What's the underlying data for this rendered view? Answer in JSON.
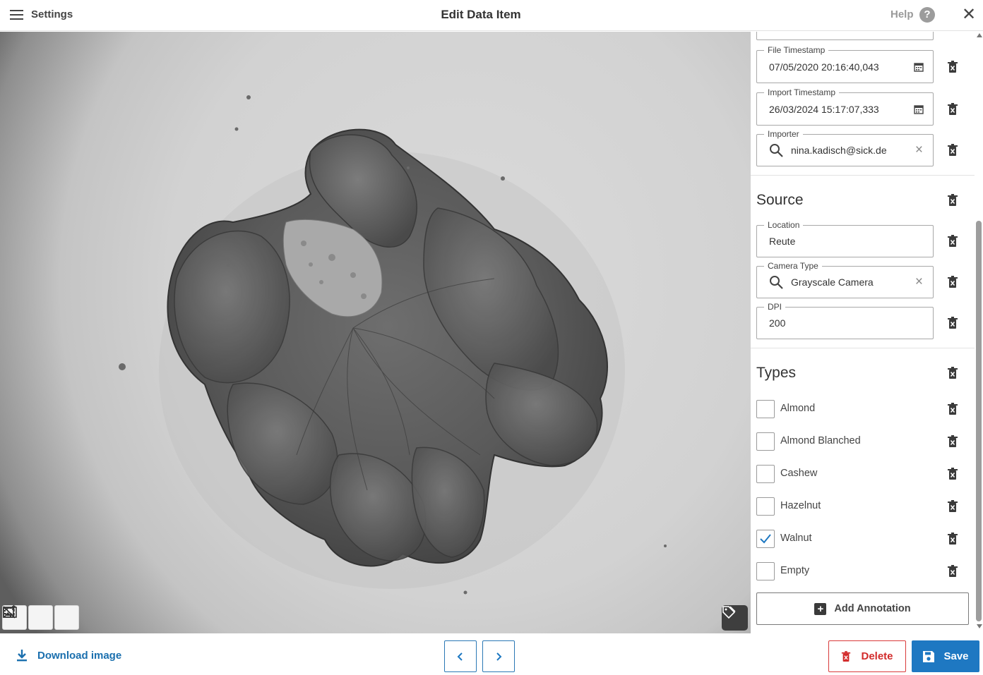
{
  "header": {
    "settings_label": "Settings",
    "title": "Edit Data Item",
    "help_label": "Help",
    "help_icon_glyph": "?",
    "close_glyph": "✕"
  },
  "image": {
    "description_icon_names": [
      "image-edit-icon",
      "crop-frame-icon",
      "selection-off-icon",
      "tag-icon"
    ]
  },
  "metadata": {
    "file_timestamp": {
      "label": "File Timestamp",
      "value": "07/05/2020  20:16:40,043"
    },
    "import_timestamp": {
      "label": "Import Timestamp",
      "value": "26/03/2024  15:17:07,333"
    },
    "importer": {
      "label": "Importer",
      "value": "nina.kadisch@sick.de"
    }
  },
  "source": {
    "title": "Source",
    "location": {
      "label": "Location",
      "value": "Reute"
    },
    "camera_type": {
      "label": "Camera Type",
      "value": "Grayscale Camera"
    },
    "dpi": {
      "label": "DPI",
      "value": "200"
    }
  },
  "types": {
    "title": "Types",
    "items": [
      {
        "label": "Almond",
        "checked": false
      },
      {
        "label": "Almond Blanched",
        "checked": false
      },
      {
        "label": "Cashew",
        "checked": false
      },
      {
        "label": "Hazelnut",
        "checked": false
      },
      {
        "label": "Walnut",
        "checked": true
      },
      {
        "label": "Empty",
        "checked": false
      }
    ],
    "add_annotation_label": "Add Annotation"
  },
  "footer": {
    "download_label": "Download image",
    "delete_label": "Delete",
    "save_label": "Save"
  },
  "colors": {
    "accent": "#1e78c2",
    "danger": "#d22b2b",
    "link": "#1a6fae"
  }
}
